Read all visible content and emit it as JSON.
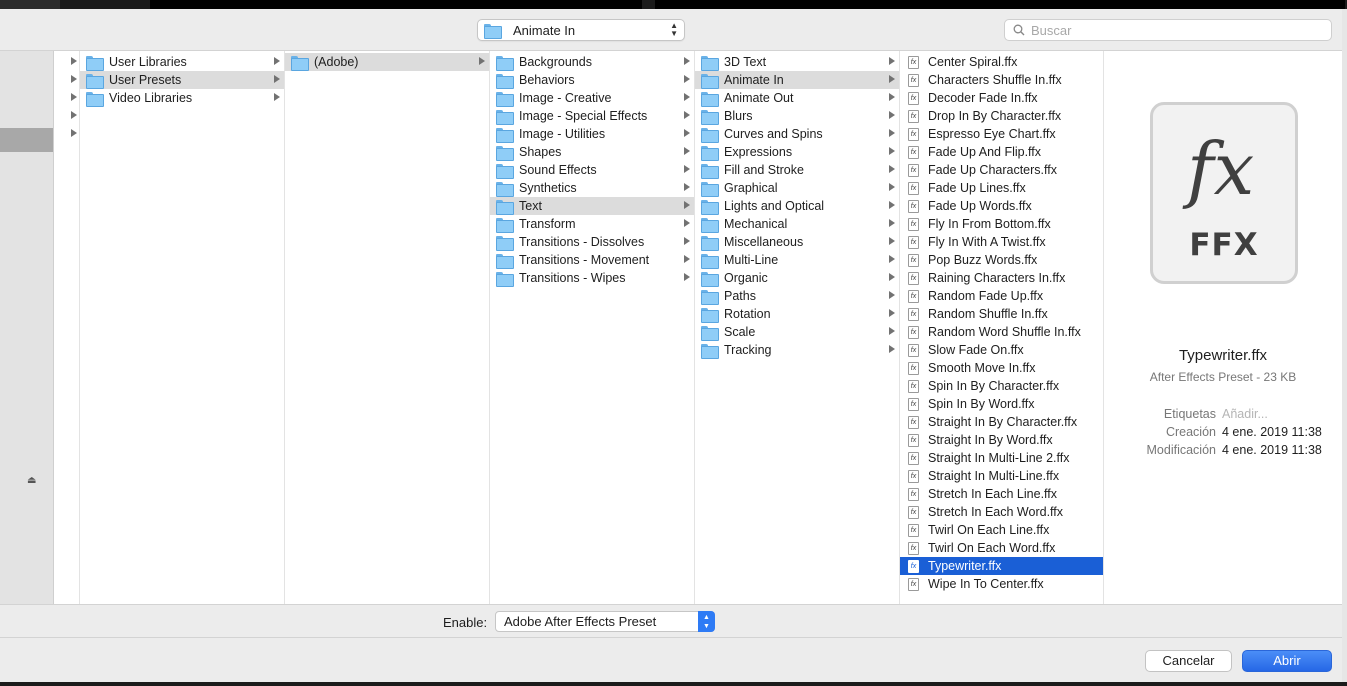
{
  "toolbar": {
    "location": "Animate In",
    "search_placeholder": "Buscar"
  },
  "columns": {
    "c0": [
      "",
      "",
      "",
      "",
      ""
    ],
    "c1": [
      {
        "label": "User Libraries",
        "selected": false
      },
      {
        "label": "User Presets",
        "selected": true
      },
      {
        "label": "Video Libraries",
        "selected": false
      }
    ],
    "c2": [
      {
        "label": "(Adobe)",
        "selected": true
      }
    ],
    "c3": [
      {
        "label": "Backgrounds"
      },
      {
        "label": "Behaviors"
      },
      {
        "label": "Image - Creative"
      },
      {
        "label": "Image - Special Effects"
      },
      {
        "label": "Image - Utilities"
      },
      {
        "label": "Shapes"
      },
      {
        "label": "Sound Effects"
      },
      {
        "label": "Synthetics"
      },
      {
        "label": "Text",
        "selected": true
      },
      {
        "label": "Transform"
      },
      {
        "label": "Transitions - Dissolves"
      },
      {
        "label": "Transitions - Movement"
      },
      {
        "label": "Transitions - Wipes"
      }
    ],
    "c4": [
      {
        "label": "3D Text"
      },
      {
        "label": "Animate In",
        "selected": true
      },
      {
        "label": "Animate Out"
      },
      {
        "label": "Blurs"
      },
      {
        "label": "Curves and Spins"
      },
      {
        "label": "Expressions"
      },
      {
        "label": "Fill and Stroke"
      },
      {
        "label": "Graphical"
      },
      {
        "label": "Lights and Optical"
      },
      {
        "label": "Mechanical"
      },
      {
        "label": "Miscellaneous"
      },
      {
        "label": "Multi-Line"
      },
      {
        "label": "Organic"
      },
      {
        "label": "Paths"
      },
      {
        "label": "Rotation"
      },
      {
        "label": "Scale"
      },
      {
        "label": "Tracking"
      }
    ],
    "c5": [
      {
        "label": "Center Spiral.ffx"
      },
      {
        "label": "Characters Shuffle In.ffx"
      },
      {
        "label": "Decoder Fade In.ffx"
      },
      {
        "label": "Drop In By Character.ffx"
      },
      {
        "label": "Espresso Eye Chart.ffx"
      },
      {
        "label": "Fade Up And Flip.ffx"
      },
      {
        "label": "Fade Up Characters.ffx"
      },
      {
        "label": "Fade Up Lines.ffx"
      },
      {
        "label": "Fade Up Words.ffx"
      },
      {
        "label": "Fly In From Bottom.ffx"
      },
      {
        "label": "Fly In With A Twist.ffx"
      },
      {
        "label": "Pop Buzz Words.ffx"
      },
      {
        "label": "Raining Characters In.ffx"
      },
      {
        "label": "Random Fade Up.ffx"
      },
      {
        "label": "Random Shuffle In.ffx"
      },
      {
        "label": "Random Word Shuffle In.ffx"
      },
      {
        "label": "Slow Fade On.ffx"
      },
      {
        "label": "Smooth Move In.ffx"
      },
      {
        "label": "Spin In By Character.ffx"
      },
      {
        "label": "Spin In By Word.ffx"
      },
      {
        "label": "Straight In By Character.ffx"
      },
      {
        "label": "Straight In By Word.ffx"
      },
      {
        "label": "Straight In Multi-Line 2.ffx"
      },
      {
        "label": "Straight In Multi-Line.ffx"
      },
      {
        "label": "Stretch In Each Line.ffx"
      },
      {
        "label": "Stretch In Each Word.ffx"
      },
      {
        "label": "Twirl On Each Line.ffx"
      },
      {
        "label": "Twirl On Each Word.ffx"
      },
      {
        "label": "Typewriter.ffx",
        "selected": true
      },
      {
        "label": "Wipe In To Center.ffx"
      }
    ]
  },
  "preview": {
    "icon_glyph": "fx",
    "icon_label": "FFX",
    "name": "Typewriter.ffx",
    "kind": "After Effects Preset - 23 KB",
    "tags_label": "Etiquetas",
    "tags_placeholder": "Añadir...",
    "created_label": "Creación",
    "created_value": "4 ene. 2019 11:38",
    "modified_label": "Modificación",
    "modified_value": "4 ene. 2019 11:38"
  },
  "enable": {
    "label": "Enable:",
    "value": "Adobe After Effects Preset"
  },
  "buttons": {
    "cancel": "Cancelar",
    "open": "Abrir"
  },
  "colors": {
    "selection_blue": "#1a5fd6",
    "folder_blue": "#8fcdf7",
    "primary_button": "#2e7bf5"
  }
}
